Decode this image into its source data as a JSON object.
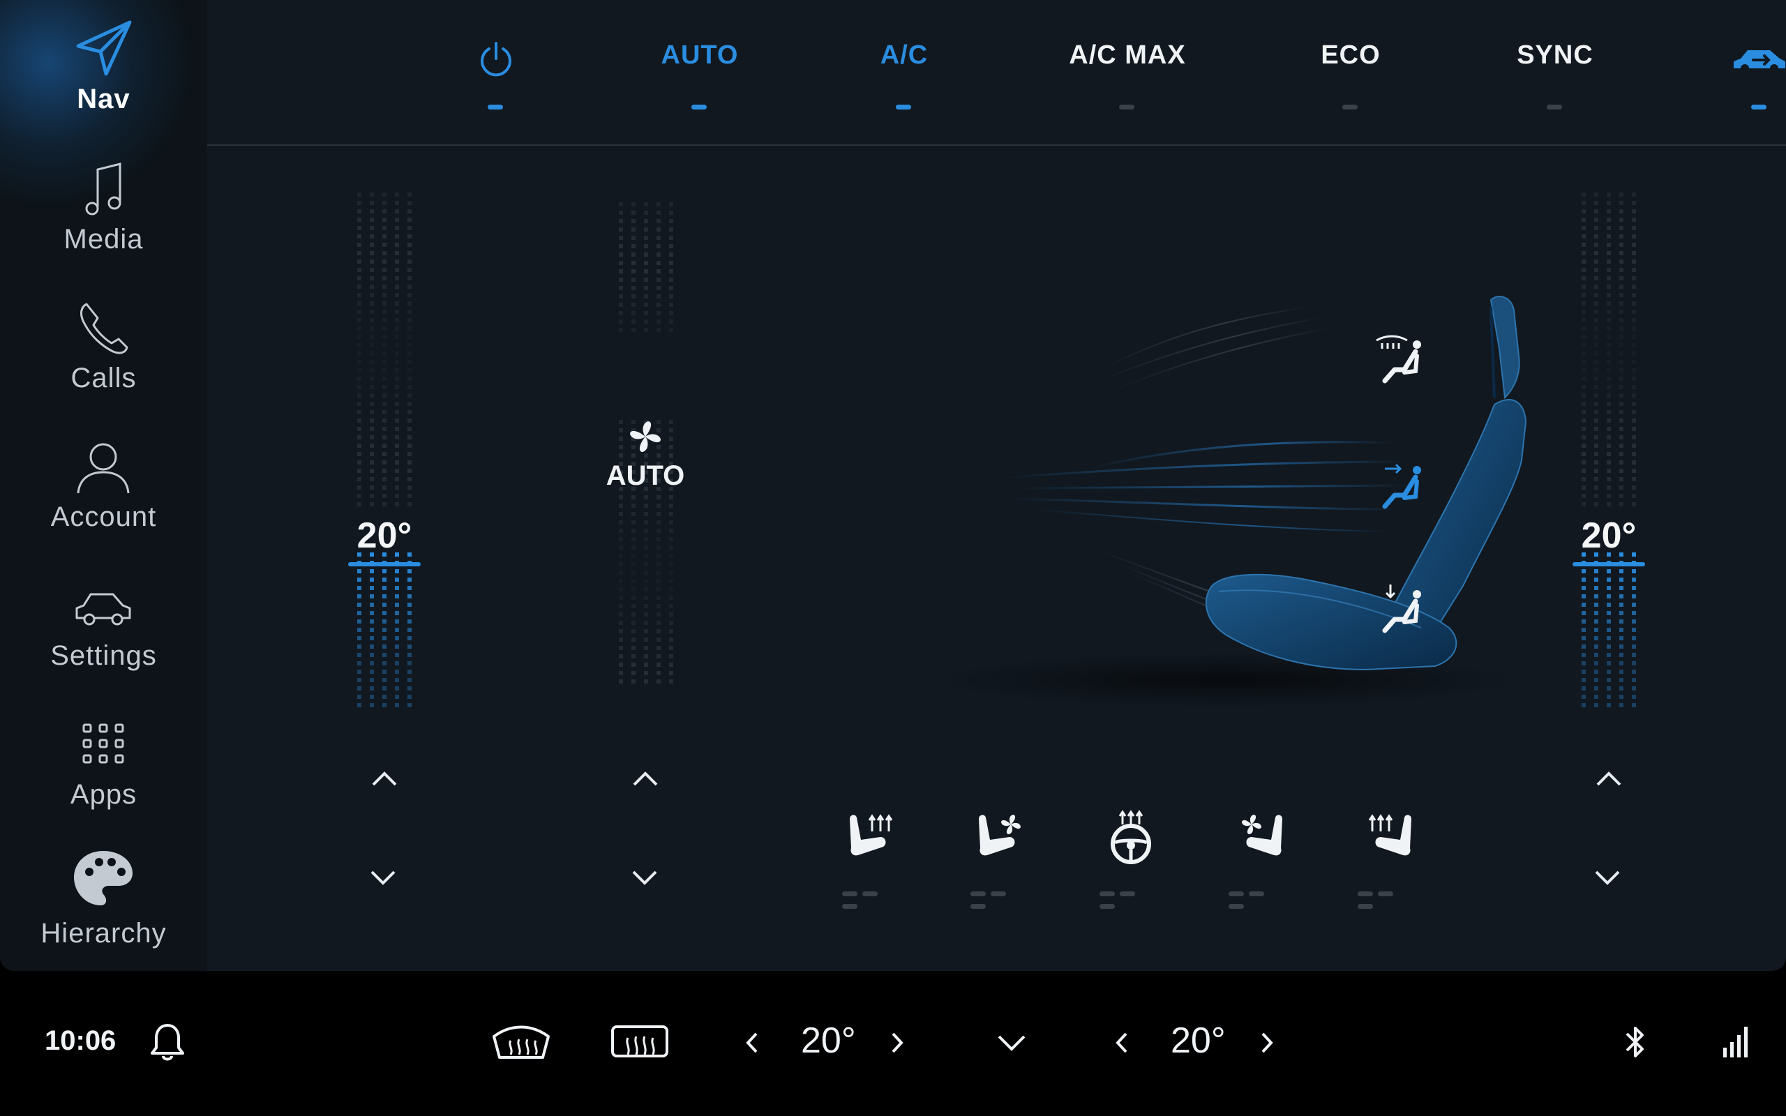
{
  "sidebar": {
    "items": [
      {
        "label": "Nav",
        "icon": "navigation-arrow-icon",
        "active": true
      },
      {
        "label": "Media",
        "icon": "music-note-icon"
      },
      {
        "label": "Calls",
        "icon": "phone-icon"
      },
      {
        "label": "Account",
        "icon": "user-icon"
      },
      {
        "label": "Settings",
        "icon": "car-icon"
      },
      {
        "label": "Apps",
        "icon": "apps-grid-icon"
      },
      {
        "label": "Hierarchy",
        "icon": "palette-icon"
      }
    ]
  },
  "topbar": {
    "power": {
      "icon": "power-icon",
      "active": true
    },
    "auto": {
      "label": "AUTO",
      "active": true
    },
    "ac": {
      "label": "A/C",
      "active": true
    },
    "acmax": {
      "label": "A/C MAX",
      "active": false
    },
    "eco": {
      "label": "ECO",
      "active": false
    },
    "sync": {
      "label": "SYNC",
      "active": false
    },
    "recirc": {
      "icon": "car-recirculation-icon",
      "active": true
    }
  },
  "climate": {
    "left_temp": "20°",
    "right_temp": "20°",
    "fan": {
      "label": "AUTO",
      "icon": "fan-icon"
    },
    "airflow_modes": [
      "windshield-airflow-icon",
      "face-airflow-icon",
      "feet-airflow-icon"
    ],
    "active_airflow_mode": "face-airflow-icon"
  },
  "seat_controls": [
    "seat-heat-left-icon",
    "seat-ventilation-left-icon",
    "steering-wheel-heat-icon",
    "seat-ventilation-right-icon",
    "seat-heat-right-icon"
  ],
  "bottombar": {
    "time": "10:06",
    "left_temp": "20°",
    "right_temp": "20°"
  },
  "colors": {
    "accent": "#2a8de0",
    "background": "#111820",
    "sidebar": "#0d1318",
    "inactive": "#3a4148"
  }
}
